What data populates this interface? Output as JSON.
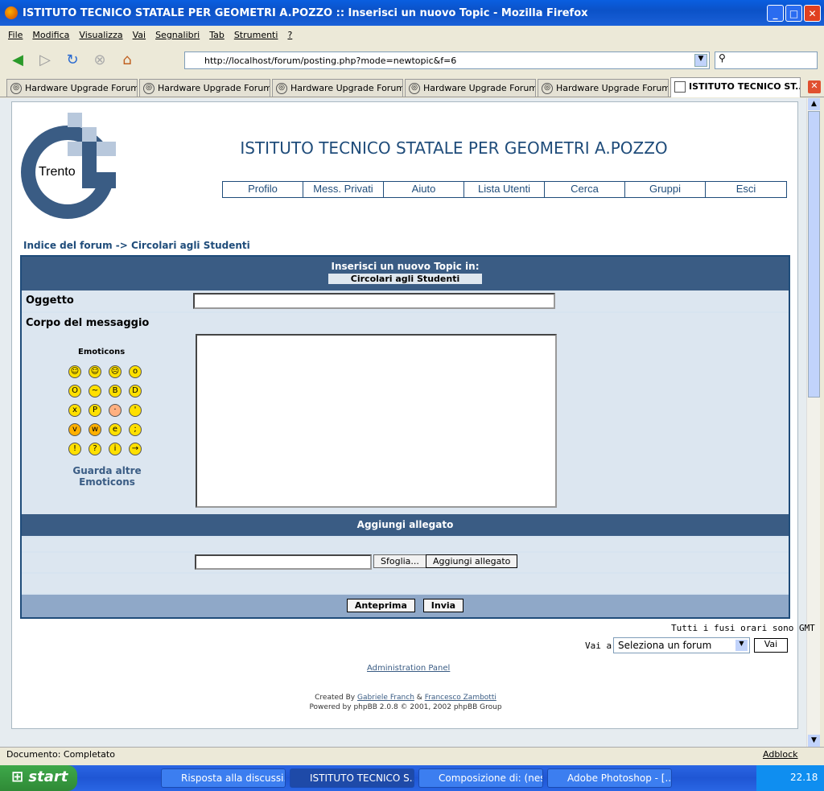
{
  "window": {
    "title": "ISTITUTO TECNICO STATALE PER GEOMETRI A.POZZO :: Inserisci un nuovo Topic - Mozilla Firefox"
  },
  "menu": [
    "File",
    "Modifica",
    "Visualizza",
    "Vai",
    "Segnalibri",
    "Tab",
    "Strumenti",
    "?"
  ],
  "url": "http://localhost/forum/posting.php?mode=newtopic&f=6",
  "tabs": [
    "Hardware Upgrade Forum...",
    "Hardware Upgrade Forum...",
    "Hardware Upgrade Forum...",
    "Hardware Upgrade Forum...",
    "Hardware Upgrade Forum...",
    "ISTITUTO TECNICO ST..."
  ],
  "site": {
    "logo_text": "Trento",
    "name": "ISTITUTO TECNICO STATALE PER GEOMETRI A.POZZO",
    "nav": [
      "Profilo",
      "Mess. Privati",
      "Aiuto",
      "Lista Utenti",
      "Cerca",
      "Gruppi",
      "Esci"
    ]
  },
  "breadcrumb": {
    "index": "Indice del forum",
    "sep": "->",
    "forum": "Circolari agli Studenti"
  },
  "form": {
    "header": "Inserisci un nuovo Topic in:",
    "forum": "Circolari agli Studenti",
    "subject_label": "Oggetto",
    "subject_value": "",
    "body_label": "Corpo del messaggio",
    "emoticons_label": "Emoticons",
    "more_emoticons": "Guarda altre Emoticons",
    "attach_header": "Aggiungi allegato",
    "browse": "Sfoglia...",
    "add_attach": "Aggiungi allegato",
    "preview": "Anteprima",
    "submit": "Invia"
  },
  "emoticons": [
    "very-happy",
    "smile",
    "sad",
    "surprised",
    "shocked",
    "confused",
    "cool",
    "laughing",
    "mad",
    "razz",
    "embarrassed",
    "crying",
    "evil",
    "twisted-evil",
    "rolling-eyes",
    "wink",
    "exclaim",
    "question",
    "idea",
    "arrow"
  ],
  "footer": {
    "timezone": "Tutti i fusi orari sono GMT",
    "jump_label": "Vai a:",
    "jump_value": "Seleziona un forum",
    "jump_button": "Vai",
    "admin": "Administration Panel",
    "created_by": "Created By",
    "author1": "Gabriele Franch",
    "amp": "&",
    "author2": "Francesco Zambotti",
    "powered": "Powered by phpBB 2.0.8 © 2001, 2002 phpBB Group"
  },
  "status": {
    "text": "Documento: Completato",
    "adblock": "Adblock"
  },
  "taskbar": {
    "start": "start",
    "items": [
      "Risposta alla discussi...",
      "ISTITUTO TECNICO S...",
      "Composizione di: (nes...",
      "Adobe Photoshop - [..."
    ],
    "clock": "22.18"
  },
  "colors": {
    "header_blue": "#3a5c84",
    "row_bg": "#dce6f0",
    "xp_blue": "#0b52c8"
  }
}
